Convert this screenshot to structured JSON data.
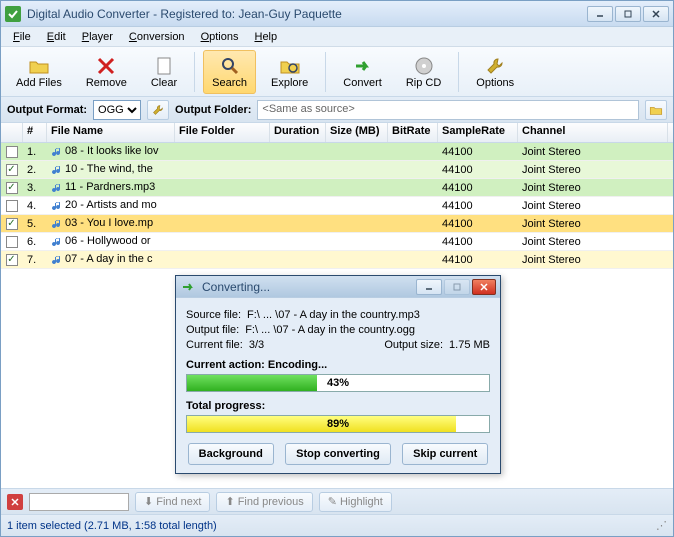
{
  "window": {
    "title": "Digital Audio Converter - Registered to: Jean-Guy Paquette"
  },
  "menu": [
    "File",
    "Edit",
    "Player",
    "Conversion",
    "Options",
    "Help"
  ],
  "toolbar": {
    "add": "Add Files",
    "remove": "Remove",
    "clear": "Clear",
    "search": "Search",
    "explore": "Explore",
    "convert": "Convert",
    "ripcd": "Rip CD",
    "options": "Options"
  },
  "format": {
    "label": "Output Format:",
    "value": "OGG",
    "folder_label": "Output Folder:",
    "folder_placeholder": "<Same as source>"
  },
  "columns": [
    "#",
    "File Name",
    "File Folder",
    "Duration",
    "Size (MB)",
    "BitRate",
    "SampleRate",
    "Channel"
  ],
  "rows": [
    {
      "chk": false,
      "num": "1.",
      "name": "08 - It looks like lov",
      "sr": "44100",
      "ch": "Joint Stereo",
      "cls": "green"
    },
    {
      "chk": true,
      "num": "2.",
      "name": "10 - The wind, the",
      "sr": "44100",
      "ch": "Joint Stereo",
      "cls": "ltgreen"
    },
    {
      "chk": true,
      "num": "3.",
      "name": "11 - Pardners.mp3",
      "sr": "44100",
      "ch": "Joint Stereo",
      "cls": "green"
    },
    {
      "chk": false,
      "num": "4.",
      "name": "20 - Artists and mo",
      "sr": "44100",
      "ch": "Joint Stereo",
      "cls": ""
    },
    {
      "chk": true,
      "num": "5.",
      "name": "03 - You I love.mp",
      "sr": "44100",
      "ch": "Joint Stereo",
      "cls": "yellow"
    },
    {
      "chk": false,
      "num": "6.",
      "name": "06 - Hollywood or",
      "sr": "44100",
      "ch": "Joint Stereo",
      "cls": ""
    },
    {
      "chk": true,
      "num": "7.",
      "name": "07 - A day in the c",
      "sr": "44100",
      "ch": "Joint Stereo",
      "cls": "ltyellow"
    }
  ],
  "findbar": {
    "findnext": "Find next",
    "findprev": "Find previous",
    "highlight": "Highlight"
  },
  "status": "1 item selected (2.71 MB, 1:58 total length)",
  "dialog": {
    "title": "Converting...",
    "src_lbl": "Source file:",
    "src": "F:\\ ... \\07 - A day in the country.mp3",
    "out_lbl": "Output file:",
    "out": "F:\\ ... \\07 - A day in the country.ogg",
    "cur_lbl": "Current file:",
    "cur": "3/3",
    "size_lbl": "Output size:",
    "size": "1.75 MB",
    "action_lbl": "Current action:",
    "action": "Encoding...",
    "action_pct": 43,
    "action_pct_txt": "43%",
    "total_lbl": "Total progress:",
    "total_pct": 89,
    "total_pct_txt": "89%",
    "bg": "Background",
    "stop": "Stop converting",
    "skip": "Skip current"
  }
}
